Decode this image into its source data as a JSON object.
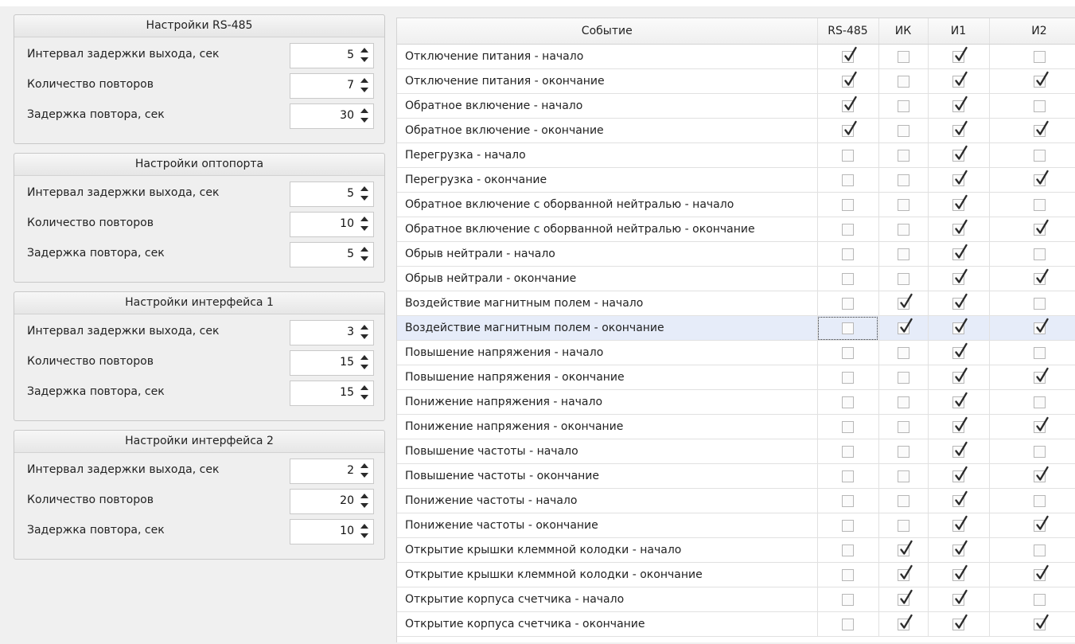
{
  "settings_panels": [
    {
      "title": "Настройки RS-485",
      "fields": [
        {
          "label": "Интервал задержки выхода, сек",
          "value": "5"
        },
        {
          "label": "Количество повторов",
          "value": "7"
        },
        {
          "label": "Задержка повтора, сек",
          "value": "30"
        }
      ]
    },
    {
      "title": "Настройки оптопорта",
      "fields": [
        {
          "label": "Интервал задержки выхода, сек",
          "value": "5"
        },
        {
          "label": "Количество повторов",
          "value": "10"
        },
        {
          "label": "Задержка повтора, сек",
          "value": "5"
        }
      ]
    },
    {
      "title": "Настройки интерфейса 1",
      "fields": [
        {
          "label": "Интервал задержки выхода, сек",
          "value": "3"
        },
        {
          "label": "Количество повторов",
          "value": "15"
        },
        {
          "label": "Задержка повтора, сек",
          "value": "15"
        }
      ]
    },
    {
      "title": "Настройки интерфейса 2",
      "fields": [
        {
          "label": "Интервал задержки выхода, сек",
          "value": "2"
        },
        {
          "label": "Количество повторов",
          "value": "20"
        },
        {
          "label": "Задержка повтора, сек",
          "value": "10"
        }
      ]
    }
  ],
  "events_table": {
    "columns": [
      "Событие",
      "RS-485",
      "ИК",
      "И1",
      "И2"
    ],
    "selected_row": 11,
    "rows": [
      {
        "event": "Отключение питания - начало",
        "checks": [
          true,
          false,
          true,
          false
        ]
      },
      {
        "event": "Отключение питания - окончание",
        "checks": [
          true,
          false,
          true,
          true
        ]
      },
      {
        "event": "Обратное включение - начало",
        "checks": [
          true,
          false,
          true,
          false
        ]
      },
      {
        "event": "Обратное включение - окончание",
        "checks": [
          true,
          false,
          true,
          true
        ]
      },
      {
        "event": "Перегрузка - начало",
        "checks": [
          false,
          false,
          true,
          false
        ]
      },
      {
        "event": "Перегрузка - окончание",
        "checks": [
          false,
          false,
          true,
          true
        ]
      },
      {
        "event": "Обратное включение с оборванной нейтралью - начало",
        "checks": [
          false,
          false,
          true,
          false
        ]
      },
      {
        "event": "Обратное включение с оборванной нейтралью - окончание",
        "checks": [
          false,
          false,
          true,
          true
        ]
      },
      {
        "event": "Обрыв нейтрали - начало",
        "checks": [
          false,
          false,
          true,
          false
        ]
      },
      {
        "event": "Обрыв нейтрали - окончание",
        "checks": [
          false,
          false,
          true,
          true
        ]
      },
      {
        "event": "Воздействие магнитным полем - начало",
        "checks": [
          false,
          true,
          true,
          false
        ]
      },
      {
        "event": "Воздействие магнитным полем - окончание",
        "checks": [
          false,
          true,
          true,
          true
        ]
      },
      {
        "event": "Повышение напряжения - начало",
        "checks": [
          false,
          false,
          true,
          false
        ]
      },
      {
        "event": "Повышение напряжения - окончание",
        "checks": [
          false,
          false,
          true,
          true
        ]
      },
      {
        "event": "Понижение напряжения - начало",
        "checks": [
          false,
          false,
          true,
          false
        ]
      },
      {
        "event": "Понижение напряжения - окончание",
        "checks": [
          false,
          false,
          true,
          true
        ]
      },
      {
        "event": "Повышение частоты - начало",
        "checks": [
          false,
          false,
          true,
          false
        ]
      },
      {
        "event": "Повышение частоты - окончание",
        "checks": [
          false,
          false,
          true,
          true
        ]
      },
      {
        "event": "Понижение частоты - начало",
        "checks": [
          false,
          false,
          true,
          false
        ]
      },
      {
        "event": "Понижение частоты - окончание",
        "checks": [
          false,
          false,
          true,
          true
        ]
      },
      {
        "event": "Открытие крышки клеммной колодки - начало",
        "checks": [
          false,
          true,
          true,
          false
        ]
      },
      {
        "event": "Открытие крышки клеммной колодки - окончание",
        "checks": [
          false,
          true,
          true,
          true
        ]
      },
      {
        "event": "Открытие корпуса счетчика - начало",
        "checks": [
          false,
          true,
          true,
          false
        ]
      },
      {
        "event": "Открытие корпуса счетчика - окончание",
        "checks": [
          false,
          true,
          true,
          true
        ]
      }
    ]
  },
  "colors": {
    "selected_row_bg": "#e6ecf9",
    "tick": "#2b2b2b",
    "panel_bg": "#efefef"
  },
  "icons": {
    "spin_up": "spin-up-icon",
    "spin_down": "spin-down-icon",
    "check": "checkmark-icon"
  }
}
